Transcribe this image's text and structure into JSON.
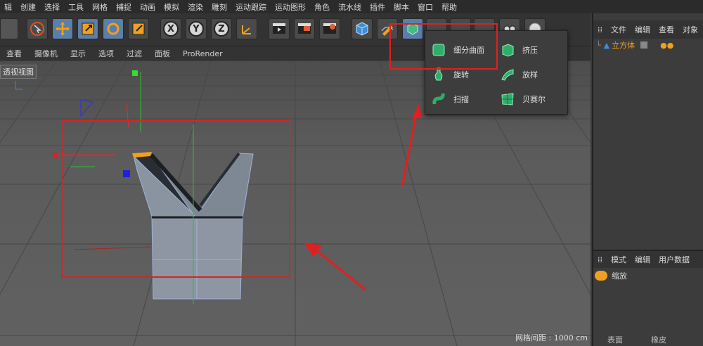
{
  "menu": [
    "辑",
    "创建",
    "选择",
    "工具",
    "网格",
    "捕捉",
    "动画",
    "模拟",
    "渲染",
    "雕刻",
    "运动跟踪",
    "运动图形",
    "角色",
    "流水线",
    "插件",
    "脚本",
    "窗口",
    "帮助"
  ],
  "subbar": [
    "查看",
    "摄像机",
    "显示",
    "选项",
    "过滤",
    "面板",
    "ProRender"
  ],
  "viewport": {
    "label": "透视视图",
    "grid_info": "网格间距 : 1000 cm"
  },
  "toolbar": {
    "axis_x": "X",
    "axis_y": "Y",
    "axis_z": "Z"
  },
  "popup_items": [
    "细分曲面",
    "挤压",
    "旋转",
    "放样",
    "扫描",
    "贝赛尔"
  ],
  "object_manager": {
    "tabs": [
      "文件",
      "编辑",
      "查看",
      "对象"
    ],
    "object_name": "立方体"
  },
  "attributes": {
    "tabs": [
      "模式",
      "编辑",
      "用户数据"
    ],
    "tool": "缩放",
    "options": [
      "表面",
      "橡皮"
    ]
  },
  "colors": {
    "accent_orange": "#f0a020",
    "highlight_red": "#e02020",
    "selection_blue": "#5a7fa8"
  }
}
